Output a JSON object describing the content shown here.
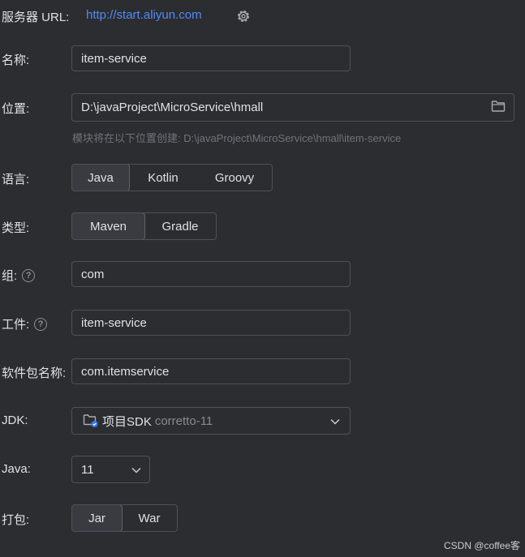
{
  "server": {
    "label": "服务器 URL:",
    "url": "http://start.aliyun.com",
    "settings_icon": "gear-icon"
  },
  "name": {
    "label": "名称:",
    "value": "item-service"
  },
  "location": {
    "label": "位置:",
    "value": "D:\\javaProject\\MicroService\\hmall",
    "browse_icon": "folder-icon",
    "hint": "模块将在以下位置创建: D:\\javaProject\\MicroService\\hmall\\item-service"
  },
  "language": {
    "label": "语言:",
    "options": [
      "Java",
      "Kotlin",
      "Groovy"
    ],
    "selected": "Java"
  },
  "type": {
    "label": "类型:",
    "options": [
      "Maven",
      "Gradle"
    ],
    "selected": "Maven"
  },
  "group": {
    "label": "组:",
    "value": "com",
    "help_icon": "help-icon"
  },
  "artifact": {
    "label": "工件:",
    "value": "item-service",
    "help_icon": "help-icon"
  },
  "package": {
    "label": "软件包名称:",
    "value": "com.itemservice"
  },
  "jdk": {
    "label": "JDK:",
    "value": "项目SDK",
    "detail": "corretto-11",
    "icon": "project-sdk-folder-icon"
  },
  "java_version": {
    "label": "Java:",
    "value": "11"
  },
  "packaging": {
    "label": "打包:",
    "options": [
      "Jar",
      "War"
    ],
    "selected": "Jar"
  },
  "watermark": "CSDN @coffee客",
  "colors": {
    "background": "#2b2d30",
    "link": "#548af7",
    "border": "#4e5157",
    "text": "#dfe1e5",
    "hint": "#6f737a",
    "sdk_badge": "#3574f0"
  }
}
